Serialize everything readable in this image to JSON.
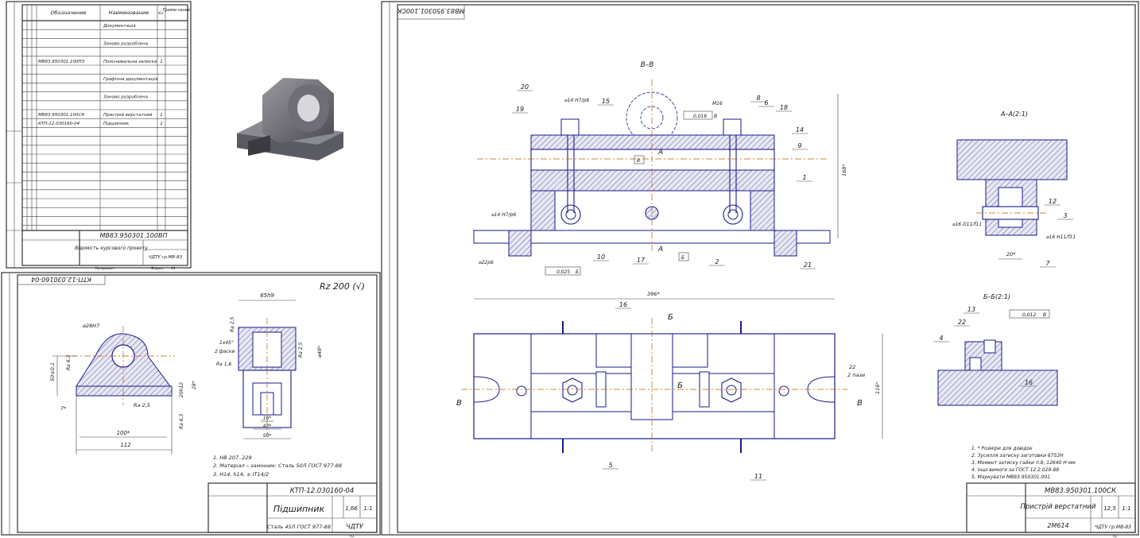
{
  "spec_sheet": {
    "headers": {
      "designation": "Обозначение",
      "name": "Наименование",
      "qty": "Кл.",
      "note": "Приме-чание"
    },
    "rows": [
      {
        "designation": "",
        "name": "Документація",
        "qty": ""
      },
      {
        "designation": "",
        "name": "",
        "qty": ""
      },
      {
        "designation": "",
        "name": "Заново розроблена",
        "qty": ""
      },
      {
        "designation": "",
        "name": "",
        "qty": ""
      },
      {
        "designation": "МВ83.950301.100ПЗ",
        "name": "Пояснювальна записка",
        "qty": "1"
      },
      {
        "designation": "",
        "name": "",
        "qty": ""
      },
      {
        "designation": "",
        "name": "Графічна документація",
        "qty": ""
      },
      {
        "designation": "",
        "name": "",
        "qty": ""
      },
      {
        "designation": "",
        "name": "Заново розроблена",
        "qty": ""
      },
      {
        "designation": "",
        "name": "",
        "qty": ""
      },
      {
        "designation": "МВ83.950301.100СК",
        "name": "Пристрій верстатний",
        "qty": "1"
      },
      {
        "designation": "КТП-12.030160-04",
        "name": "Підшипник",
        "qty": "1"
      }
    ],
    "title_code": "МВ83.950301.100ВП",
    "doc_name": "Відомість курсового проекту",
    "org": "ЧДТУ гр.МВ-83",
    "format_label": "Формат",
    "format_value": "А4",
    "copied_label": "Копировал"
  },
  "part_drawing": {
    "stamp_code_rotated": "КТП-12.030160-04",
    "roughness": "Rz 200 (√)",
    "dims": {
      "bore": "⌀28H7",
      "height_center": "50±0,1",
      "width_112": "112",
      "width_100": "100*",
      "ra25": "Ra 2,5",
      "ra63": "Ra 6,3",
      "dim_7": "7*",
      "dim_20h12": "20h12",
      "dim_28": "28*",
      "dim_65h9": "65h9",
      "chamfer": "1x45°",
      "chamfers": "2 фаски",
      "ra16": "Ra 1,6",
      "dim_48": "⌀48*",
      "dim_16": "16*",
      "dim_42": "42*",
      "dim_50": "50*"
    },
    "notes": [
      "1. НВ 207..229",
      "2. Матеріал – замінник: Сталь 50Л ГОСТ 977-88",
      "3. Н14, h14, ± IT14/2"
    ],
    "title_code": "КТП-12.030160-04",
    "part_name": "Підшипник",
    "material": "Сталь 45Л ГОСТ 977-88",
    "mass": "1,66",
    "scale": "1:1",
    "org": "ЧДТУ",
    "format_value": "А3"
  },
  "assembly_drawing": {
    "stamp_code_rotated": "МВ83.950301.100СК",
    "section_vv": "В–В",
    "section_aa": "А–А(2:1)",
    "section_bb": "Б–Б(2:1)",
    "labels": {
      "dim_168": "168*",
      "dim_396": "396*",
      "dim_116": "116*",
      "fit_14": "⌀14 H7/p6",
      "fit_14b": "⌀14 H7/p6",
      "fit_22": "⌀22p6",
      "m16": "M16",
      "tol1": "0,016",
      "tol1_base": "В",
      "tol2": "0,025",
      "tol2_base": "Б",
      "tol3": "0,012",
      "tol3_base": "В",
      "base_b": "Б",
      "base_v": "В",
      "fit_16d": "⌀16 D11/f11",
      "fit_16": "⌀16 H11/f11",
      "dim_20": "20*",
      "slot_22": "22",
      "slot_2paz": "2 пази",
      "a_mark": "А",
      "b_mark": "Б",
      "v_mark": "В"
    },
    "callouts": [
      "20",
      "19",
      "15",
      "8",
      "6",
      "18",
      "14",
      "9",
      "1",
      "2",
      "10",
      "17",
      "21",
      "16",
      "5",
      "11",
      "12",
      "3",
      "7",
      "13",
      "22",
      "4",
      "16"
    ],
    "notes": [
      "1. * Розміри для довідок",
      "2. Зусилля затиску заготовки 6753Н",
      "3. Момент затиску гайки п.8, 12640 Н·мм",
      "4. Інші вимоги за ГОСТ 12.2.029-88",
      "5. Маркувати МВ83.950301.001"
    ],
    "title_code": "МВ83.950301.100СК",
    "name": "Пристрій верстатний",
    "machine": "2М614",
    "mass": "12,5",
    "scale": "1:1",
    "org": "ЧДТУ гр.МВ-83",
    "format_value": "А1"
  }
}
